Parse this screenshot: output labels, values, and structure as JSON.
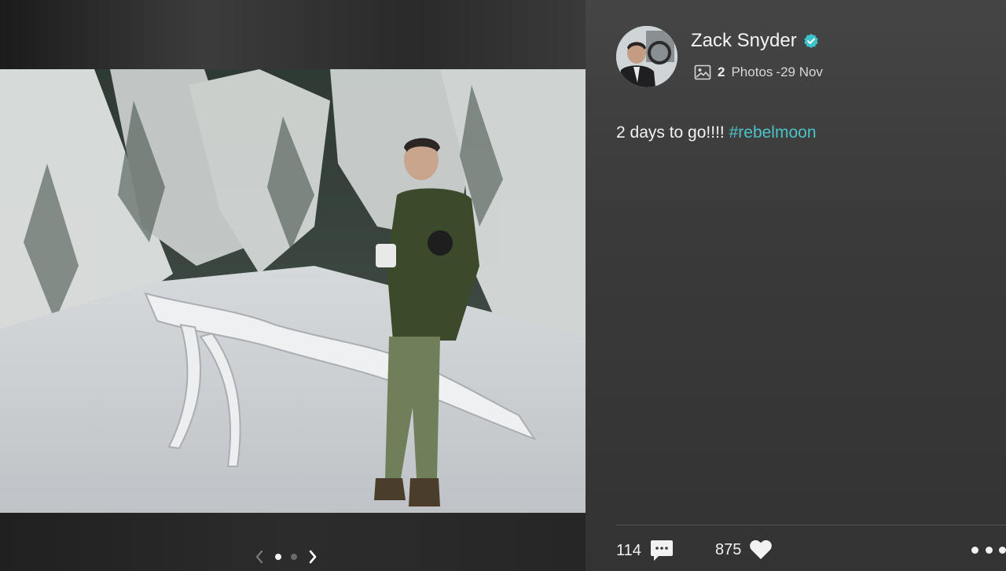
{
  "post": {
    "author": "Zack Snyder",
    "photo_count": "2",
    "photo_label": "Photos",
    "date": "-29 Nov",
    "caption_text": "2 days to go!!!! ",
    "hashtag": "#rebelmoon",
    "comments": "114",
    "likes": "875"
  },
  "pager": {
    "total": 2,
    "current": 1
  },
  "icons": {
    "verified": "verified-check-icon",
    "photos": "image-icon",
    "comment": "speech-bubble-icon",
    "like": "heart-icon",
    "more": "ellipsis-icon",
    "prev": "chevron-left-icon",
    "next": "chevron-right-icon"
  },
  "colors": {
    "hashtag": "#4cc2c9",
    "verified_badge": "#3cc2c8"
  }
}
